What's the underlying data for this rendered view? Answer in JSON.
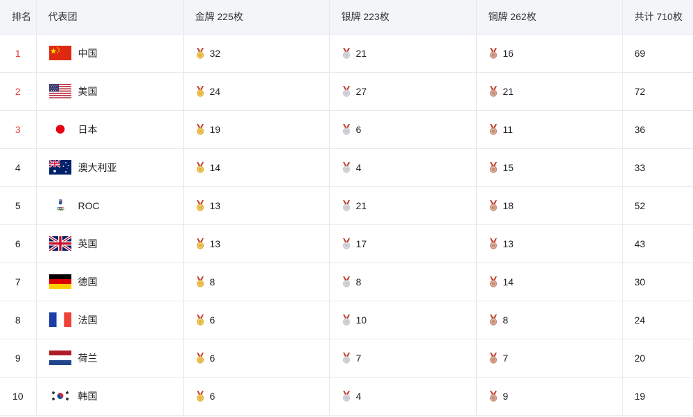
{
  "headers": [
    "排名",
    "代表团",
    "金牌 225枚",
    "银牌 223枚",
    "铜牌 262枚",
    "共计 710枚"
  ],
  "medal_colors": {
    "gold": "#e7b53c",
    "silver": "#c9c9cf",
    "bronze": "#c98f78"
  },
  "rank_highlight_color": "#e83f3f",
  "rows": [
    {
      "rank": "1",
      "flag": "china-flag-icon",
      "name": "中国",
      "gold": "32",
      "silver": "21",
      "bronze": "16",
      "total": "69"
    },
    {
      "rank": "2",
      "flag": "usa-flag-icon",
      "name": "美国",
      "gold": "24",
      "silver": "27",
      "bronze": "21",
      "total": "72"
    },
    {
      "rank": "3",
      "flag": "japan-flag-icon",
      "name": "日本",
      "gold": "19",
      "silver": "6",
      "bronze": "11",
      "total": "36"
    },
    {
      "rank": "4",
      "flag": "australia-flag-icon",
      "name": "澳大利亚",
      "gold": "14",
      "silver": "4",
      "bronze": "15",
      "total": "33"
    },
    {
      "rank": "5",
      "flag": "roc-emblem-icon",
      "name": "ROC",
      "gold": "13",
      "silver": "21",
      "bronze": "18",
      "total": "52"
    },
    {
      "rank": "6",
      "flag": "uk-flag-icon",
      "name": "英国",
      "gold": "13",
      "silver": "17",
      "bronze": "13",
      "total": "43"
    },
    {
      "rank": "7",
      "flag": "germany-flag-icon",
      "name": "德国",
      "gold": "8",
      "silver": "8",
      "bronze": "14",
      "total": "30"
    },
    {
      "rank": "8",
      "flag": "france-flag-icon",
      "name": "法国",
      "gold": "6",
      "silver": "10",
      "bronze": "8",
      "total": "24"
    },
    {
      "rank": "9",
      "flag": "netherlands-flag-icon",
      "name": "荷兰",
      "gold": "6",
      "silver": "7",
      "bronze": "7",
      "total": "20"
    },
    {
      "rank": "10",
      "flag": "korea-flag-icon",
      "name": "韩国",
      "gold": "6",
      "silver": "4",
      "bronze": "9",
      "total": "19"
    }
  ]
}
